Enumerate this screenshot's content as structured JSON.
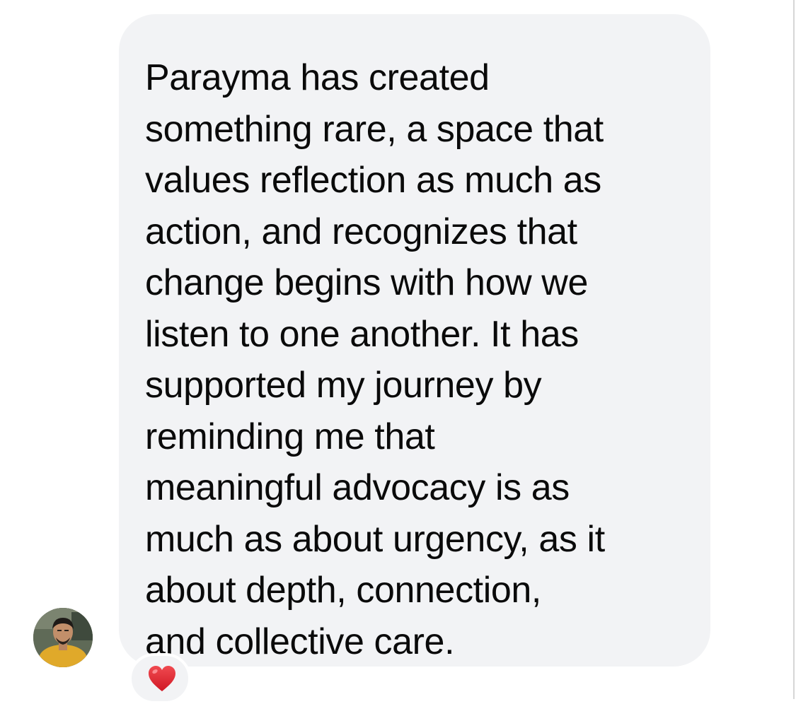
{
  "message": {
    "text": "Parayma has created\nsomething rare, a space that\nvalues reflection as much as\naction, and recognizes that\nchange begins with how we\nlisten to one another. It has\nsupported my journey by\nreminding me that\nmeaningful advocacy is as\nmuch as about urgency, as it\nabout depth, connection,\nand collective care."
  },
  "sender": {
    "avatar_icon": "user-photo-avatar"
  },
  "reaction": {
    "icon": "red-heart-icon",
    "color": "#e8232d"
  },
  "colors": {
    "bubble": "#f2f3f5",
    "text": "#0a0a0a",
    "background": "#ffffff"
  }
}
